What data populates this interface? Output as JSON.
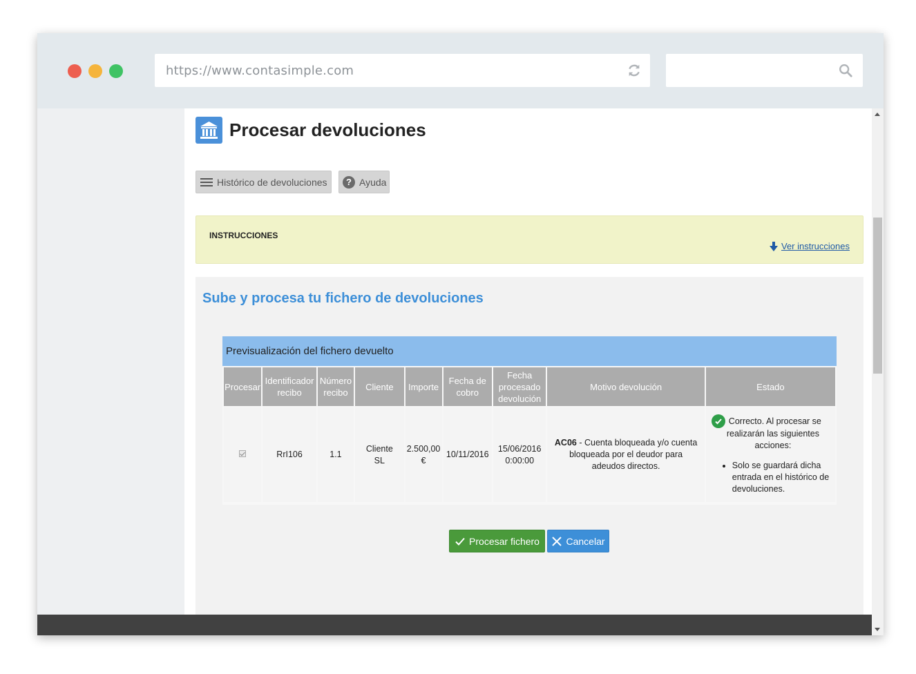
{
  "browser": {
    "url": "https://www.contasimple.com"
  },
  "page": {
    "title": "Procesar devoluciones"
  },
  "toolbar": {
    "history_label": "Histórico de devoluciones",
    "help_label": "Ayuda",
    "help_glyph": "?"
  },
  "instructions": {
    "title": "INSTRUCCIONES",
    "link_label": "Ver instrucciones"
  },
  "upload_panel": {
    "title": "Sube y procesa tu fichero de devoluciones",
    "preview_title": "Previsualización del fichero devuelto",
    "columns": {
      "procesar": "Procesar",
      "identificador": [
        "Identificador",
        "recibo"
      ],
      "numero": [
        "Número",
        "recibo"
      ],
      "cliente": "Cliente",
      "importe": "Importe",
      "fecha_cobro": [
        "Fecha de",
        "cobro"
      ],
      "fecha_procesado": [
        "Fecha",
        "procesado",
        "devolución"
      ],
      "motivo": "Motivo devolución",
      "estado": "Estado"
    },
    "row": {
      "procesar_checked": true,
      "identificador": "RrI106",
      "numero": "1.1",
      "cliente": [
        "Cliente",
        "SL"
      ],
      "importe": [
        "2.500,00",
        "€"
      ],
      "fecha_cobro": "10/11/2016",
      "fecha_procesado": [
        "15/06/2016",
        "0:00:00"
      ],
      "motivo_code": "AC06",
      "motivo_text": " - Cuenta bloqueada y/o cuenta bloqueada por el deudor para adeudos directos.",
      "estado_line1": "Correcto. Al procesar se",
      "estado_line2": "realizarán las siguientes acciones:",
      "estado_bullet": "Solo se guardará dicha entrada en el histórico de devoluciones."
    },
    "process_button": "Procesar fichero",
    "cancel_button": "Cancelar"
  },
  "colors": {
    "title_icon": "#4a90d9",
    "preview_header": "#8bbcec",
    "process_green": "#4a9a3b",
    "cancel_blue": "#3d8fd8",
    "instructions_bg": "#f1f3c9"
  }
}
